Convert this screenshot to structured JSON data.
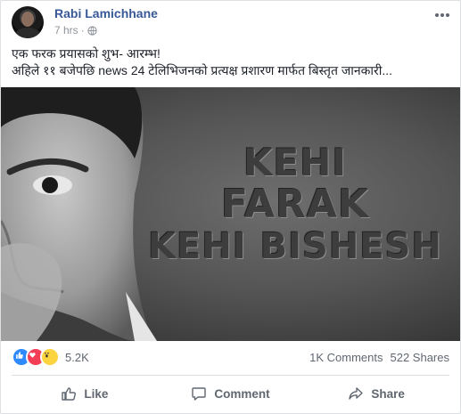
{
  "post": {
    "author": "Rabi Lamichhane",
    "time": "7 hrs",
    "separator": "·",
    "text_line1": "एक फरक प्रयासको शुभ- आरम्भ!",
    "text_line2": "अहिले ११ बजेपछि news 24 टेलिभिजनको प्रत्यक्ष प्रशारण मार्फत बिस्तृत जानकारी..."
  },
  "media": {
    "headline": [
      "KEHI",
      "FARAK",
      "KEHI BISHESH"
    ]
  },
  "stats": {
    "reactions_count": "5.2K",
    "reaction_icons": [
      "like-icon",
      "love-icon",
      "wow-icon"
    ],
    "comments": "1K Comments",
    "shares": "522 Shares"
  },
  "actions": {
    "like": "Like",
    "comment": "Comment",
    "share": "Share"
  },
  "colors": {
    "author": "#385898",
    "like": "#2e89ff",
    "love": "#f33e58",
    "wow": "#fcd440"
  }
}
